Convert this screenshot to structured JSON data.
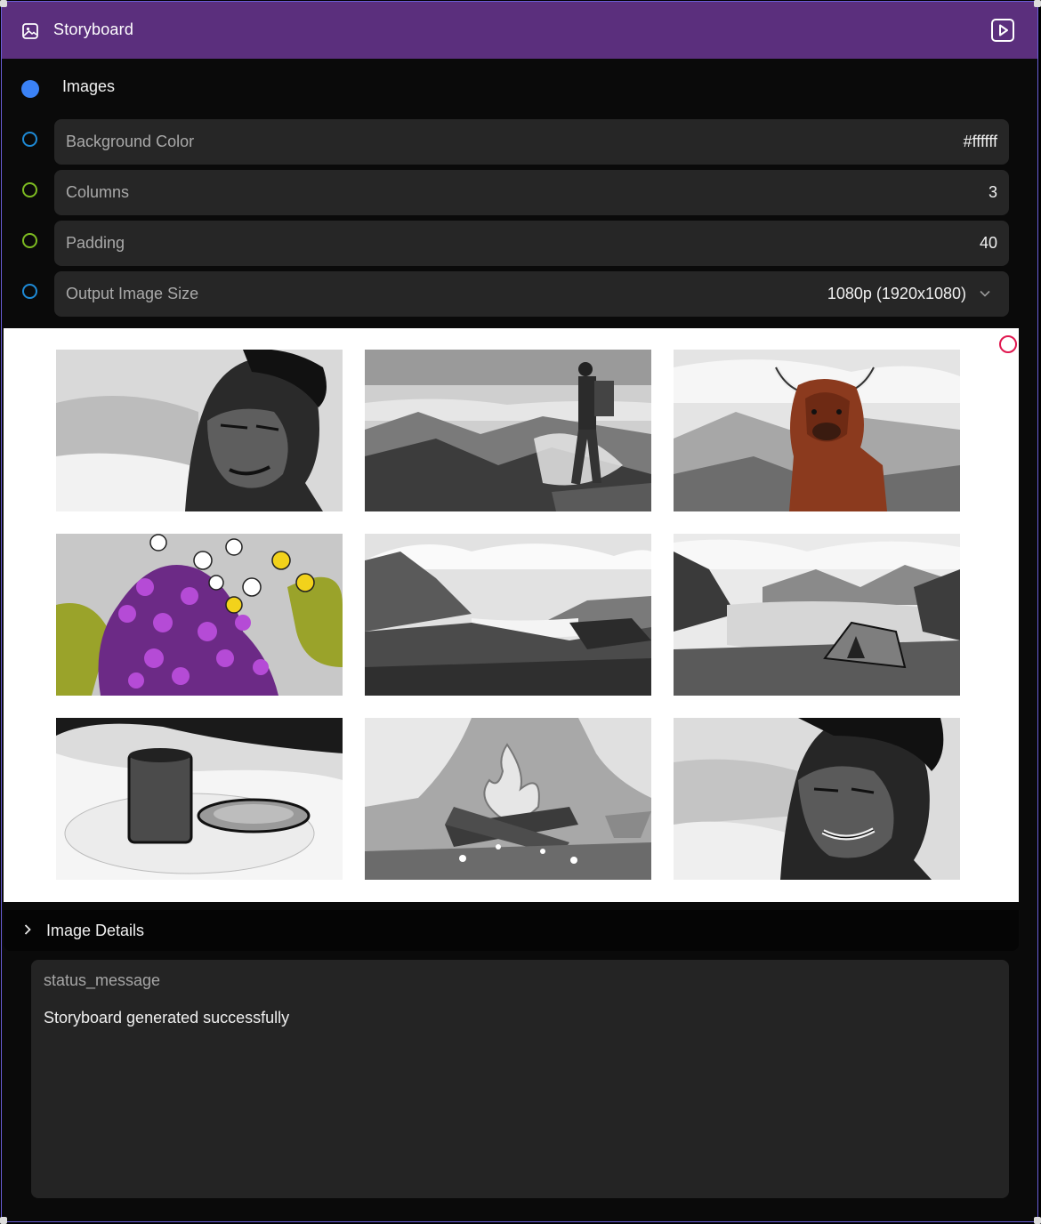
{
  "header": {
    "title": "Storyboard",
    "image_icon": "image-icon",
    "run_icon": "play-square-icon",
    "color": "#5b2f7d"
  },
  "inputs": {
    "images_label": "Images",
    "fields": [
      {
        "label": "Background Color",
        "value": "#ffffff",
        "socket_color": "#1e8ad6"
      },
      {
        "label": "Columns",
        "value": "3",
        "socket_color": "#7dbb21"
      },
      {
        "label": "Padding",
        "value": "40",
        "socket_color": "#7dbb21"
      },
      {
        "label": "Output Image Size",
        "value": "1080p (1920x1080)",
        "socket_color": "#1e8ad6"
      }
    ]
  },
  "storyboard": {
    "background": "#ffffff",
    "columns": 3,
    "frames": [
      "portrait-man-serious",
      "hiker-on-cliff",
      "highland-cow",
      "purple-flowers",
      "mountain-valley-lake",
      "tent-by-lake",
      "cup-and-plate",
      "campfire",
      "portrait-man-smiling"
    ]
  },
  "details": {
    "label": "Image Details",
    "icon": "chevron-right-icon"
  },
  "status": {
    "key": "status_message",
    "message": "Storyboard generated successfully"
  }
}
